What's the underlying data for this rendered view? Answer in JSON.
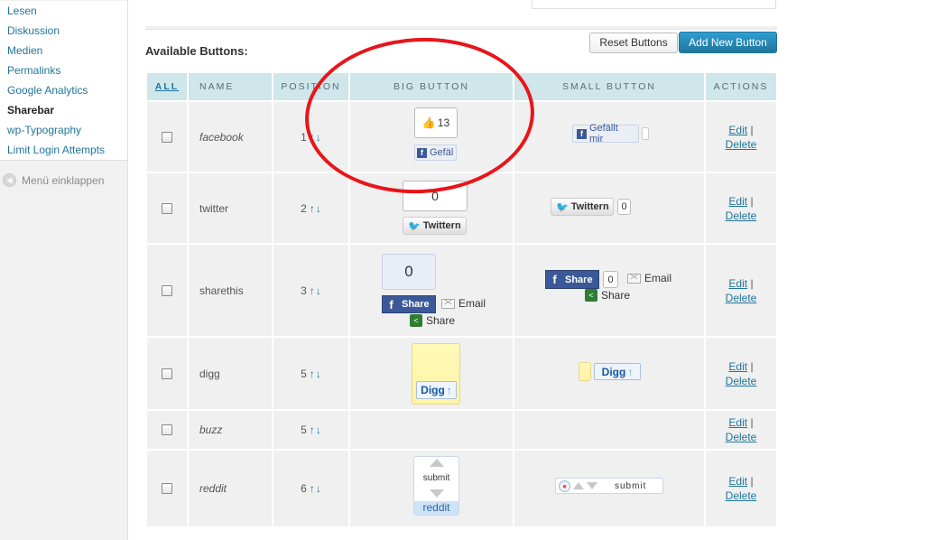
{
  "sidebar": {
    "items": [
      {
        "label": "Lesen"
      },
      {
        "label": "Diskussion"
      },
      {
        "label": "Medien"
      },
      {
        "label": "Permalinks"
      },
      {
        "label": "Google Analytics"
      },
      {
        "label": "Sharebar"
      },
      {
        "label": "wp-Typography"
      },
      {
        "label": "Limit Login Attempts"
      }
    ],
    "collapse_label": "Menü einklappen"
  },
  "section_title": "Available Buttons:",
  "toolbar": {
    "reset_label": "Reset Buttons",
    "add_label": "Add New Button"
  },
  "table": {
    "headers": {
      "all": "ALL",
      "name": "NAME",
      "position": "POSITION",
      "big": "BIG BUTTON",
      "small": "SMALL BUTTON",
      "actions": "ACTIONS"
    },
    "edit_label": "Edit",
    "delete_label": "Delete",
    "separator": "|",
    "up_arrow": "↑",
    "down_arrow": "↓",
    "rows": [
      {
        "name": "facebook",
        "position": "1"
      },
      {
        "name": "twitter",
        "position": "2"
      },
      {
        "name": "sharethis",
        "position": "3"
      },
      {
        "name": "digg",
        "position": "5"
      },
      {
        "name": "buzz",
        "position": "5"
      },
      {
        "name": "reddit",
        "position": "6"
      }
    ]
  },
  "widgets": {
    "fb_big_count": "13",
    "fb_big_label": "Gefäl",
    "fb_small_label": "Gefällt mir",
    "tw_big_count": "0",
    "tw_label": "Twittern",
    "tw_small_count": "0",
    "st_big_count": "0",
    "st_share": "Share",
    "st_email": "Email",
    "st_small_count": "0",
    "digg_label": "Digg",
    "reddit_submit": "submit",
    "reddit_label": "reddit",
    "reddit_small_submit": "submit"
  },
  "colors": {
    "annotation": "#e8151b",
    "link": "#21759b",
    "header_bg": "#cfe6ea"
  }
}
